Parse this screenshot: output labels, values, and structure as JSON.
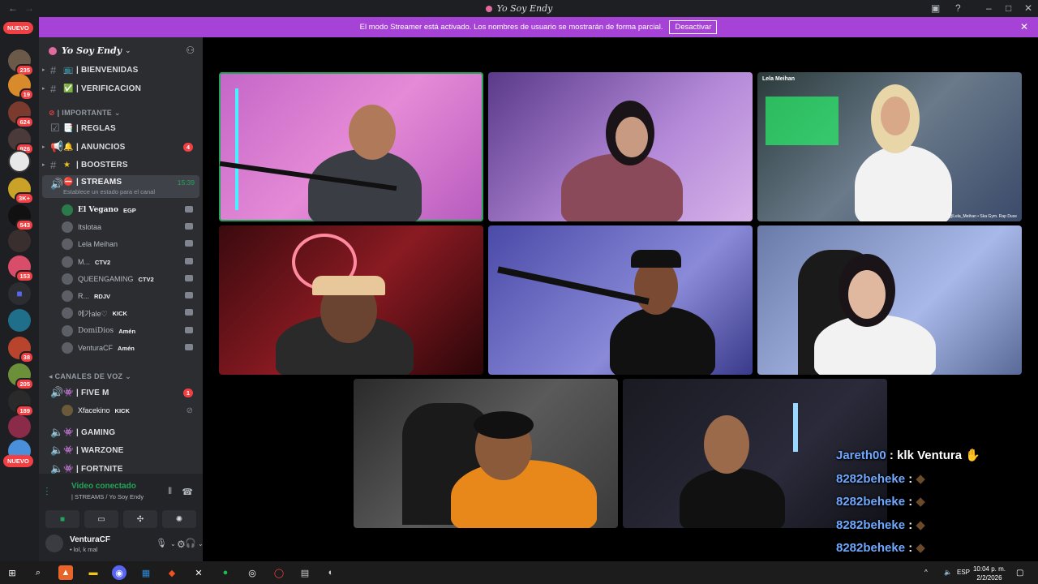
{
  "window": {
    "title": "Yo Soy Endy",
    "back": "←",
    "forward": "→"
  },
  "banner": {
    "text": "El modo Streamer está activado. Los nombres de usuario se mostrarán de forma parcial.",
    "button": "Desactivar"
  },
  "servers": {
    "nuevo_top": "NUEVO",
    "nuevo_bottom": "NUEVO",
    "badges": [
      "235",
      "19",
      "624",
      "926",
      "3K+",
      "543",
      "153",
      "38",
      "205",
      "189"
    ]
  },
  "guild": {
    "name": "Yo Soy Endy"
  },
  "channels": {
    "bienvenidas": {
      "emoji": "📺",
      "name": "| BIENVENIDAS"
    },
    "verificacion": {
      "emoji": "✅",
      "name": "| VERIFICACION"
    },
    "cat_importante": "| IMPORTANTE",
    "reglas": {
      "emoji": "📑",
      "name": "| REGLAS"
    },
    "anuncios": {
      "emoji": "🔔",
      "name": "| ANUNCIOS",
      "count": "4"
    },
    "boosters": {
      "emoji": "★",
      "name": "| BOOSTERS"
    },
    "streams": {
      "emoji": "⛔",
      "name": "| STREAMS",
      "time": "15:39",
      "status": "Establece un estado para el canal"
    },
    "cat_voz": "CANALES DE VOZ",
    "fivem": {
      "name": "| FIVE M",
      "count": "1"
    },
    "gaming": {
      "name": "| GAMING"
    },
    "warzone": {
      "name": "| WARZONE"
    },
    "fortnite": {
      "name": "| FORTNITE"
    }
  },
  "stream_users": [
    {
      "name": "El Vegano",
      "tag": "EGP"
    },
    {
      "name": "Itslotaa",
      "tag": ""
    },
    {
      "name": "Lela Meihan",
      "tag": ""
    },
    {
      "name": "M...",
      "tag": "CTV2"
    },
    {
      "name": "QUEENGAMING",
      "tag": "CTV2"
    },
    {
      "name": "R...",
      "tag": "RDJV"
    },
    {
      "name": "에가ale♡",
      "tag": "KICK"
    },
    {
      "name": "DomiDios",
      "tag": "Amén"
    },
    {
      "name": "VenturaCF",
      "tag": "Amén"
    }
  ],
  "fivem_users": [
    {
      "name": "Xfacekino",
      "tag": "KICK"
    }
  ],
  "voice_panel": {
    "status": "Video conectado",
    "location": "| STREAMS / Yo Soy Endy"
  },
  "user": {
    "name": "VenturaCF",
    "status": "• lol, k mal"
  },
  "video": {
    "tile3_label": "Lela Meihan",
    "tile3_caption": "@Lela_Meihan • Ska Gym. Rap Duse"
  },
  "chat": [
    {
      "user": "Jareth00",
      "msg": "klk Ventura"
    },
    {
      "user": "8282beheke",
      "msg": ""
    },
    {
      "user": "8282beheke",
      "msg": ""
    },
    {
      "user": "8282beheke",
      "msg": ""
    },
    {
      "user": "8282beheke",
      "msg": ""
    },
    {
      "user": "8282beheke",
      "msg": ""
    }
  ],
  "taskbar": {
    "lang": "ESP",
    "time": "10:04 p. m.",
    "date": "2/2/2026"
  }
}
